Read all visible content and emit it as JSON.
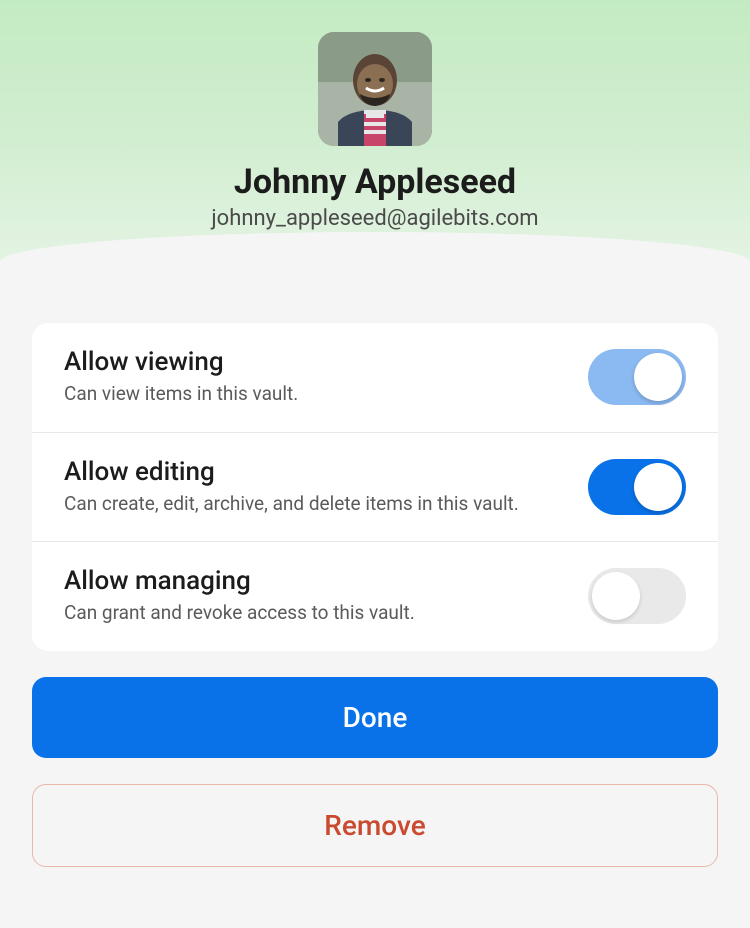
{
  "user": {
    "name": "Johnny Appleseed",
    "email": "johnny_appleseed@agilebits.com"
  },
  "permissions": [
    {
      "title": "Allow viewing",
      "desc": "Can view items in this vault.",
      "enabled": true,
      "toggle_style": "on-light"
    },
    {
      "title": "Allow editing",
      "desc": "Can create, edit, archive, and delete items in this vault.",
      "enabled": true,
      "toggle_style": "on"
    },
    {
      "title": "Allow managing",
      "desc": "Can grant and revoke access to this vault.",
      "enabled": false,
      "toggle_style": "off"
    }
  ],
  "buttons": {
    "done": "Done",
    "remove": "Remove"
  },
  "colors": {
    "primary": "#0a72e8",
    "danger": "#c94a2e",
    "header_gradient_start": "#c3ebc2",
    "header_gradient_end": "#e8f5e7"
  }
}
